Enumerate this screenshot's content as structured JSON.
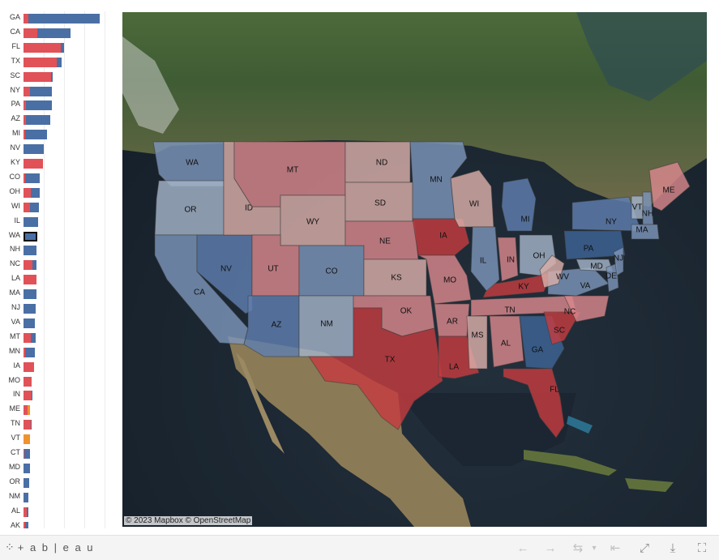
{
  "brand": {
    "name": "+ a b | e a u",
    "mark": "⁘"
  },
  "attribution": "© 2023 Mapbox  © OpenStreetMap",
  "colors": {
    "red": "#e05258",
    "blue": "#4a6fa5",
    "orange": "#f0922f",
    "dark_red": "#c43c3f",
    "light_red": "#d9888c",
    "pale_red": "#d9aea9",
    "light_blue": "#7d95b9",
    "pale_blue": "#a4b3c8",
    "mid_blue": "#5f7fb0",
    "dark_blue": "#3d6496"
  },
  "chart_data": {
    "type": "bar",
    "orientation": "horizontal-stacked",
    "categories": [
      "GA",
      "CA",
      "FL",
      "TX",
      "SC",
      "NY",
      "PA",
      "AZ",
      "MI",
      "NV",
      "KY",
      "CO",
      "OH",
      "WI",
      "IL",
      "WA",
      "NH",
      "NC",
      "LA",
      "MA",
      "NJ",
      "VA",
      "MT",
      "MN",
      "IA",
      "MO",
      "IN",
      "ME",
      "TN",
      "VT",
      "CT",
      "MD",
      "OR",
      "NM",
      "AL",
      "AK"
    ],
    "series": [
      {
        "color": "red",
        "values": [
          6,
          17,
          46,
          41,
          34,
          8,
          3,
          3,
          2,
          0,
          24,
          2,
          9,
          8,
          0,
          0,
          0,
          11,
          16,
          0,
          0,
          0,
          9,
          2,
          13,
          10,
          10,
          5,
          9,
          0,
          1,
          0,
          0,
          0,
          4,
          2
        ]
      },
      {
        "color": "blue",
        "values": [
          88,
          41,
          4,
          6,
          2,
          27,
          32,
          30,
          27,
          25,
          0,
          18,
          11,
          11,
          18,
          17,
          16,
          5,
          0,
          16,
          15,
          14,
          6,
          12,
          0,
          0,
          1,
          0,
          1,
          0,
          7,
          8,
          7,
          6,
          2,
          4
        ]
      },
      {
        "color": "orange",
        "values": [
          0,
          0,
          0,
          0,
          0,
          0,
          0,
          0,
          0,
          0,
          0,
          0,
          0,
          0,
          0,
          0,
          0,
          0,
          0,
          0,
          0,
          0,
          0,
          0,
          0,
          0,
          0,
          3,
          0,
          8,
          0,
          0,
          0,
          0,
          0,
          0
        ]
      }
    ],
    "selected": "WA",
    "gridlines": [
      25,
      50,
      75,
      100
    ]
  },
  "map": {
    "states": [
      {
        "code": "WA",
        "fill": "light_blue",
        "label": "WA"
      },
      {
        "code": "OR",
        "fill": "pale_blue",
        "label": "OR"
      },
      {
        "code": "CA",
        "fill": "light_blue",
        "label": "CA"
      },
      {
        "code": "NV",
        "fill": "mid_blue",
        "label": "NV"
      },
      {
        "code": "ID",
        "fill": "pale_red",
        "label": "ID"
      },
      {
        "code": "MT",
        "fill": "light_red",
        "label": "MT"
      },
      {
        "code": "WY",
        "fill": "pale_red",
        "label": "WY"
      },
      {
        "code": "UT",
        "fill": "light_red",
        "label": "UT"
      },
      {
        "code": "AZ",
        "fill": "mid_blue",
        "label": "AZ"
      },
      {
        "code": "CO",
        "fill": "light_blue",
        "label": "CO"
      },
      {
        "code": "NM",
        "fill": "pale_blue",
        "label": "NM"
      },
      {
        "code": "ND",
        "fill": "pale_red",
        "label": "ND"
      },
      {
        "code": "SD",
        "fill": "pale_red",
        "label": "SD"
      },
      {
        "code": "NE",
        "fill": "light_red",
        "label": "NE"
      },
      {
        "code": "KS",
        "fill": "pale_red",
        "label": "KS"
      },
      {
        "code": "OK",
        "fill": "light_red",
        "label": "OK"
      },
      {
        "code": "TX",
        "fill": "dark_red",
        "label": "TX"
      },
      {
        "code": "MN",
        "fill": "light_blue",
        "label": "MN"
      },
      {
        "code": "IA",
        "fill": "dark_red",
        "label": "IA"
      },
      {
        "code": "MO",
        "fill": "light_red",
        "label": "MO"
      },
      {
        "code": "AR",
        "fill": "light_red",
        "label": "AR"
      },
      {
        "code": "LA",
        "fill": "dark_red",
        "label": "LA"
      },
      {
        "code": "WI",
        "fill": "pale_red",
        "label": "WI"
      },
      {
        "code": "IL",
        "fill": "light_blue",
        "label": "IL"
      },
      {
        "code": "MI",
        "fill": "mid_blue",
        "label": "MI"
      },
      {
        "code": "IN",
        "fill": "light_red",
        "label": "IN"
      },
      {
        "code": "OH",
        "fill": "pale_blue",
        "label": "OH"
      },
      {
        "code": "KY",
        "fill": "dark_red",
        "label": "KY"
      },
      {
        "code": "TN",
        "fill": "light_red",
        "label": "TN"
      },
      {
        "code": "MS",
        "fill": "pale_red",
        "label": "MS"
      },
      {
        "code": "AL",
        "fill": "light_red",
        "label": "AL"
      },
      {
        "code": "GA",
        "fill": "dark_blue",
        "label": "GA"
      },
      {
        "code": "FL",
        "fill": "dark_red",
        "label": "FL"
      },
      {
        "code": "SC",
        "fill": "dark_red",
        "label": "SC"
      },
      {
        "code": "NC",
        "fill": "light_red",
        "label": "NC"
      },
      {
        "code": "VA",
        "fill": "light_blue",
        "label": "VA"
      },
      {
        "code": "WV",
        "fill": "pale_red",
        "label": "WV"
      },
      {
        "code": "PA",
        "fill": "dark_blue",
        "label": "PA"
      },
      {
        "code": "NY",
        "fill": "mid_blue",
        "label": "NY"
      },
      {
        "code": "MD",
        "fill": "pale_blue",
        "label": "MD"
      },
      {
        "code": "DE",
        "fill": "light_blue",
        "label": "DE"
      },
      {
        "code": "NJ",
        "fill": "light_blue",
        "label": "NJ"
      },
      {
        "code": "VT",
        "fill": "pale_blue",
        "label": "VT"
      },
      {
        "code": "NH",
        "fill": "light_blue",
        "label": "NH"
      },
      {
        "code": "MA",
        "fill": "light_blue",
        "label": "MA"
      },
      {
        "code": "ME",
        "fill": "light_red",
        "label": "ME"
      }
    ]
  },
  "toolbar": {
    "buttons": [
      {
        "name": "undo-button",
        "icon": "←",
        "disabled": true
      },
      {
        "name": "redo-button",
        "icon": "→",
        "disabled": true
      },
      {
        "name": "revert-button",
        "icon": "⇆",
        "disabled": true
      },
      {
        "name": "revert-menu-button",
        "icon": "▾",
        "disabled": true
      },
      {
        "name": "pause-button",
        "icon": "⇤",
        "disabled": true
      },
      {
        "name": "share-button",
        "icon": "⤢",
        "disabled": false
      },
      {
        "name": "download-button",
        "icon": "⤓",
        "disabled": false
      },
      {
        "name": "fullscreen-button",
        "icon": "⛶",
        "disabled": false
      }
    ]
  }
}
